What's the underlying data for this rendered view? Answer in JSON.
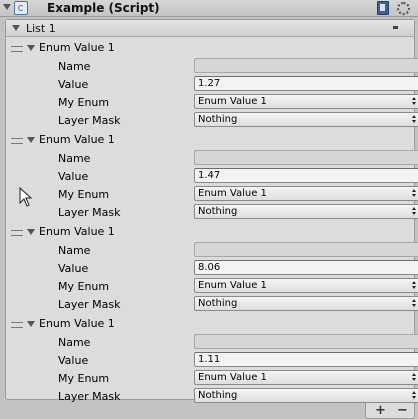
{
  "header": {
    "title": "Example (Script)",
    "foldout_icon": "triangle-down-icon",
    "script_icon": "script-icon",
    "help_icon": "book-icon",
    "settings_icon": "gear-icon"
  },
  "list": {
    "title": "List 1",
    "elements": [
      {
        "title": "Enum Value 1",
        "name_label": "Name",
        "name_value": "",
        "value_label": "Value",
        "value": "1.27",
        "enum_label": "My Enum",
        "enum_value": "Enum Value 1",
        "mask_label": "Layer Mask",
        "mask_value": "Nothing"
      },
      {
        "title": "Enum Value 1",
        "name_label": "Name",
        "name_value": "",
        "value_label": "Value",
        "value": "1.47",
        "enum_label": "My Enum",
        "enum_value": "Enum Value 1",
        "mask_label": "Layer Mask",
        "mask_value": "Nothing"
      },
      {
        "title": "Enum Value 1",
        "name_label": "Name",
        "name_value": "",
        "value_label": "Value",
        "value": "8.06",
        "enum_label": "My Enum",
        "enum_value": "Enum Value 1",
        "mask_label": "Layer Mask",
        "mask_value": "Nothing"
      },
      {
        "title": "Enum Value 1",
        "name_label": "Name",
        "name_value": "",
        "value_label": "Value",
        "value": "1.11",
        "enum_label": "My Enum",
        "enum_value": "Enum Value 1",
        "mask_label": "Layer Mask",
        "mask_value": "Nothing"
      }
    ]
  },
  "footer": {
    "add_label": "+",
    "remove_label": "−"
  }
}
